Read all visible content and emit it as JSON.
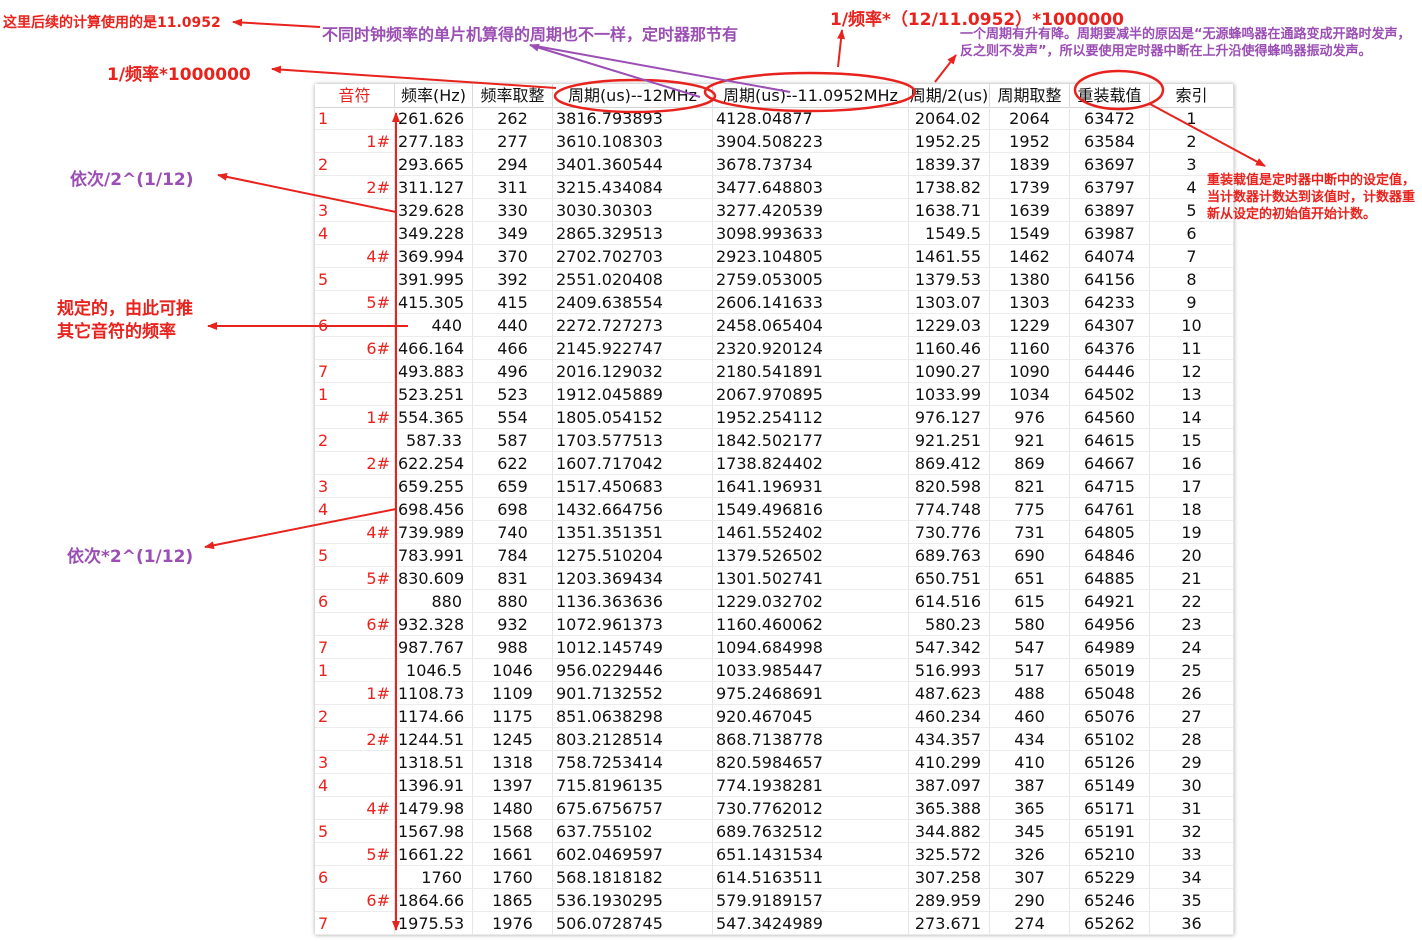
{
  "headers": [
    "音符",
    "频率(Hz)",
    "频率取整",
    "周期(us)--12MHz",
    "周期(us)--11.0952MHz",
    "周期/2(us)",
    "周期取整",
    "重装载值",
    "索引"
  ],
  "rows": [
    [
      "1",
      "261.626",
      "262",
      "3816.793893",
      "4128.04877",
      "2064.02",
      "2064",
      "63472",
      "1"
    ],
    [
      "1#",
      "277.183",
      "277",
      "3610.108303",
      "3904.508223",
      "1952.25",
      "1952",
      "63584",
      "2"
    ],
    [
      "2",
      "293.665",
      "294",
      "3401.360544",
      "3678.73734",
      "1839.37",
      "1839",
      "63697",
      "3"
    ],
    [
      "2#",
      "311.127",
      "311",
      "3215.434084",
      "3477.648803",
      "1738.82",
      "1739",
      "63797",
      "4"
    ],
    [
      "3",
      "329.628",
      "330",
      "3030.30303",
      "3277.420539",
      "1638.71",
      "1639",
      "63897",
      "5"
    ],
    [
      "4",
      "349.228",
      "349",
      "2865.329513",
      "3098.993633",
      "1549.5",
      "1549",
      "63987",
      "6"
    ],
    [
      "4#",
      "369.994",
      "370",
      "2702.702703",
      "2923.104805",
      "1461.55",
      "1462",
      "64074",
      "7"
    ],
    [
      "5",
      "391.995",
      "392",
      "2551.020408",
      "2759.053005",
      "1379.53",
      "1380",
      "64156",
      "8"
    ],
    [
      "5#",
      "415.305",
      "415",
      "2409.638554",
      "2606.141633",
      "1303.07",
      "1303",
      "64233",
      "9"
    ],
    [
      "6",
      "440",
      "440",
      "2272.727273",
      "2458.065404",
      "1229.03",
      "1229",
      "64307",
      "10"
    ],
    [
      "6#",
      "466.164",
      "466",
      "2145.922747",
      "2320.920124",
      "1160.46",
      "1160",
      "64376",
      "11"
    ],
    [
      "7",
      "493.883",
      "496",
      "2016.129032",
      "2180.541891",
      "1090.27",
      "1090",
      "64446",
      "12"
    ],
    [
      "1",
      "523.251",
      "523",
      "1912.045889",
      "2067.970895",
      "1033.99",
      "1034",
      "64502",
      "13"
    ],
    [
      "1#",
      "554.365",
      "554",
      "1805.054152",
      "1952.254112",
      "976.127",
      "976",
      "64560",
      "14"
    ],
    [
      "2",
      "587.33",
      "587",
      "1703.577513",
      "1842.502177",
      "921.251",
      "921",
      "64615",
      "15"
    ],
    [
      "2#",
      "622.254",
      "622",
      "1607.717042",
      "1738.824402",
      "869.412",
      "869",
      "64667",
      "16"
    ],
    [
      "3",
      "659.255",
      "659",
      "1517.450683",
      "1641.196931",
      "820.598",
      "821",
      "64715",
      "17"
    ],
    [
      "4",
      "698.456",
      "698",
      "1432.664756",
      "1549.496816",
      "774.748",
      "775",
      "64761",
      "18"
    ],
    [
      "4#",
      "739.989",
      "740",
      "1351.351351",
      "1461.552402",
      "730.776",
      "731",
      "64805",
      "19"
    ],
    [
      "5",
      "783.991",
      "784",
      "1275.510204",
      "1379.526502",
      "689.763",
      "690",
      "64846",
      "20"
    ],
    [
      "5#",
      "830.609",
      "831",
      "1203.369434",
      "1301.502741",
      "650.751",
      "651",
      "64885",
      "21"
    ],
    [
      "6",
      "880",
      "880",
      "1136.363636",
      "1229.032702",
      "614.516",
      "615",
      "64921",
      "22"
    ],
    [
      "6#",
      "932.328",
      "932",
      "1072.961373",
      "1160.460062",
      "580.23",
      "580",
      "64956",
      "23"
    ],
    [
      "7",
      "987.767",
      "988",
      "1012.145749",
      "1094.684998",
      "547.342",
      "547",
      "64989",
      "24"
    ],
    [
      "1",
      "1046.5",
      "1046",
      "956.0229446",
      "1033.985447",
      "516.993",
      "517",
      "65019",
      "25"
    ],
    [
      "1#",
      "1108.73",
      "1109",
      "901.7132552",
      "975.2468691",
      "487.623",
      "488",
      "65048",
      "26"
    ],
    [
      "2",
      "1174.66",
      "1175",
      "851.0638298",
      "920.467045",
      "460.234",
      "460",
      "65076",
      "27"
    ],
    [
      "2#",
      "1244.51",
      "1245",
      "803.2128514",
      "868.7138778",
      "434.357",
      "434",
      "65102",
      "28"
    ],
    [
      "3",
      "1318.51",
      "1318",
      "758.7253414",
      "820.5984657",
      "410.299",
      "410",
      "65126",
      "29"
    ],
    [
      "4",
      "1396.91",
      "1397",
      "715.8196135",
      "774.1938281",
      "387.097",
      "387",
      "65149",
      "30"
    ],
    [
      "4#",
      "1479.98",
      "1480",
      "675.6756757",
      "730.7762012",
      "365.388",
      "365",
      "65171",
      "31"
    ],
    [
      "5",
      "1567.98",
      "1568",
      "637.755102",
      "689.7632512",
      "344.882",
      "345",
      "65191",
      "32"
    ],
    [
      "5#",
      "1661.22",
      "1661",
      "602.0469597",
      "651.1431534",
      "325.572",
      "326",
      "65210",
      "33"
    ],
    [
      "6",
      "1760",
      "1760",
      "568.1818182",
      "614.5163511",
      "307.258",
      "307",
      "65229",
      "34"
    ],
    [
      "6#",
      "1864.66",
      "1865",
      "536.1930295",
      "579.9189157",
      "289.959",
      "290",
      "65246",
      "35"
    ],
    [
      "7",
      "1975.53",
      "1976",
      "506.0728745",
      "547.3424989",
      "273.671",
      "274",
      "65262",
      "36"
    ]
  ],
  "annotations": {
    "calc_note": "这里后续的计算使用的是11.0952",
    "clock_note": "不同时钟频率的单片机算得的周期也不一样，定时器那节有",
    "formula_11m": "1/频率*（12/11.0952）*1000000",
    "formula_12m": "1/频率*1000000",
    "half_period_note": "一个周期有升有降。周期要减半的原因是“无源蜂鸣器在通路变成开路时发声，反之则不发声”，所以要使用定时器中断在上升沿使得蜂鸣器振动发声。",
    "reload_note": "重装载值是定时器中断中的设定值，当计数器计数达到该值时，计数器重新从设定的初始值开始计数。",
    "divide_note": "依次/2^(1/12)",
    "multiply_note": "依次*2^(1/12)",
    "standard_note_line1": "规定的，由此可推",
    "standard_note_line2": "其它音符的频率"
  },
  "colors": {
    "red": "#e8231e",
    "purple": "#9b4fb4"
  }
}
